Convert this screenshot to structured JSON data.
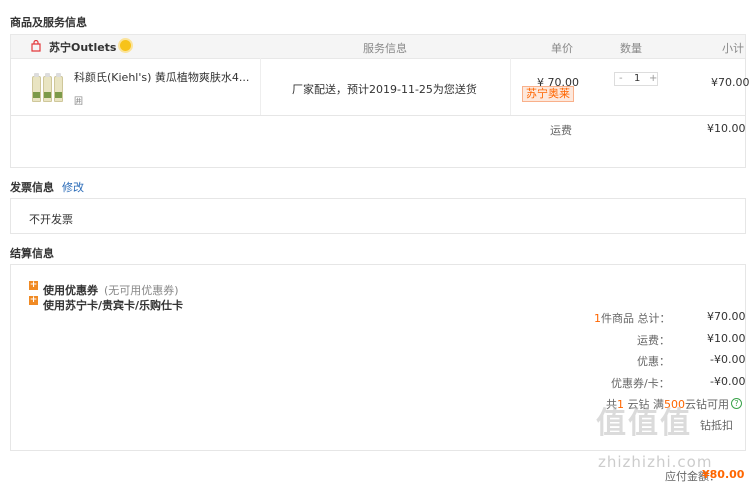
{
  "goods_section": {
    "title": "商品及服务信息",
    "columns": {
      "service": "服务信息",
      "price": "单价",
      "qty": "数量",
      "subtotal": "小计"
    },
    "shop_name": "苏宁Outlets",
    "item": {
      "name": "科颜氏(Kiehl's) 黄瓜植物爽肤水4...",
      "sub_icon": "囲",
      "service_text": "厂家配送，预计2019-11-25为您送货",
      "price": "¥ 70.00",
      "tag": "苏宁奥莱",
      "qty_minus": "-",
      "qty": "1",
      "qty_plus": "+",
      "subtotal": "¥70.00"
    },
    "shipping_label": "运费",
    "shipping_value": "¥10.00"
  },
  "invoice_section": {
    "title": "发票信息",
    "edit_link": "修改",
    "value": "不开发票"
  },
  "settlement_section": {
    "title": "结算信息",
    "coupon_label": "使用优惠券",
    "coupon_note": "(无可用优惠券)",
    "card_label": "使用苏宁卡/贵宾卡/乐购仕卡",
    "summary": {
      "count": "1",
      "count_suffix": "件商品 总计：",
      "total": "¥70.00",
      "shipping_label": "运费：",
      "shipping": "¥10.00",
      "discount_label": "优惠：",
      "discount": "-¥0.00",
      "coupon_card_label": "优惠券/卡：",
      "coupon_card": "-¥0.00",
      "cloud_prefix": "共",
      "cloud_count": "1",
      "cloud_mid": " 云钻 满",
      "cloud_threshold": "500",
      "cloud_suffix": "云钻可用",
      "cloud_partial": "钻抵扣"
    }
  },
  "footer": {
    "payable_label": "应付金额：",
    "payable_value": "¥80.00"
  },
  "watermark": {
    "main": "值值值",
    "url": "zhizhizhi.com"
  },
  "colors": {
    "accent": "#ff6600",
    "link": "#2a6bb8",
    "header_bg": "#f5f5f5"
  }
}
